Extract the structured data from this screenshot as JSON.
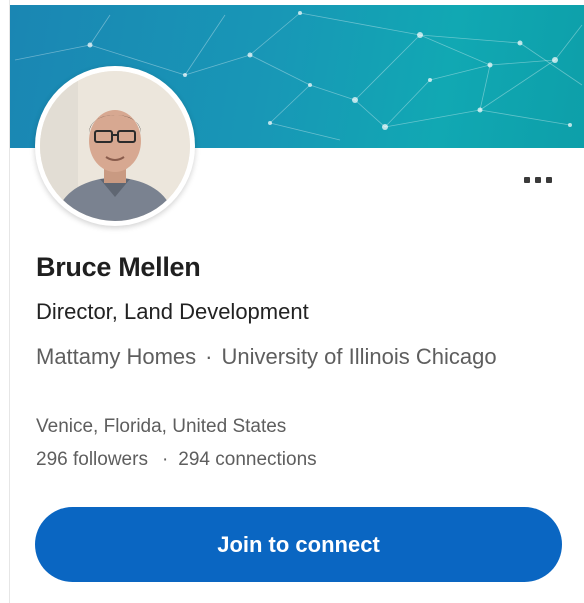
{
  "profile": {
    "name": "Bruce Mellen",
    "headline": "Director, Land Development",
    "company": "Mattamy Homes",
    "org_separator": "·",
    "school": "University of Illinois Chicago",
    "location": "Venice, Florida, United States",
    "followers": "296 followers",
    "stats_separator": "·",
    "connections": "294 connections"
  },
  "actions": {
    "join_label": "Join to connect",
    "more_icon": "more-horizontal-icon"
  },
  "colors": {
    "banner_start": "#1a86b3",
    "banner_end": "#0d9fa9",
    "primary_button": "#0a66c2"
  }
}
